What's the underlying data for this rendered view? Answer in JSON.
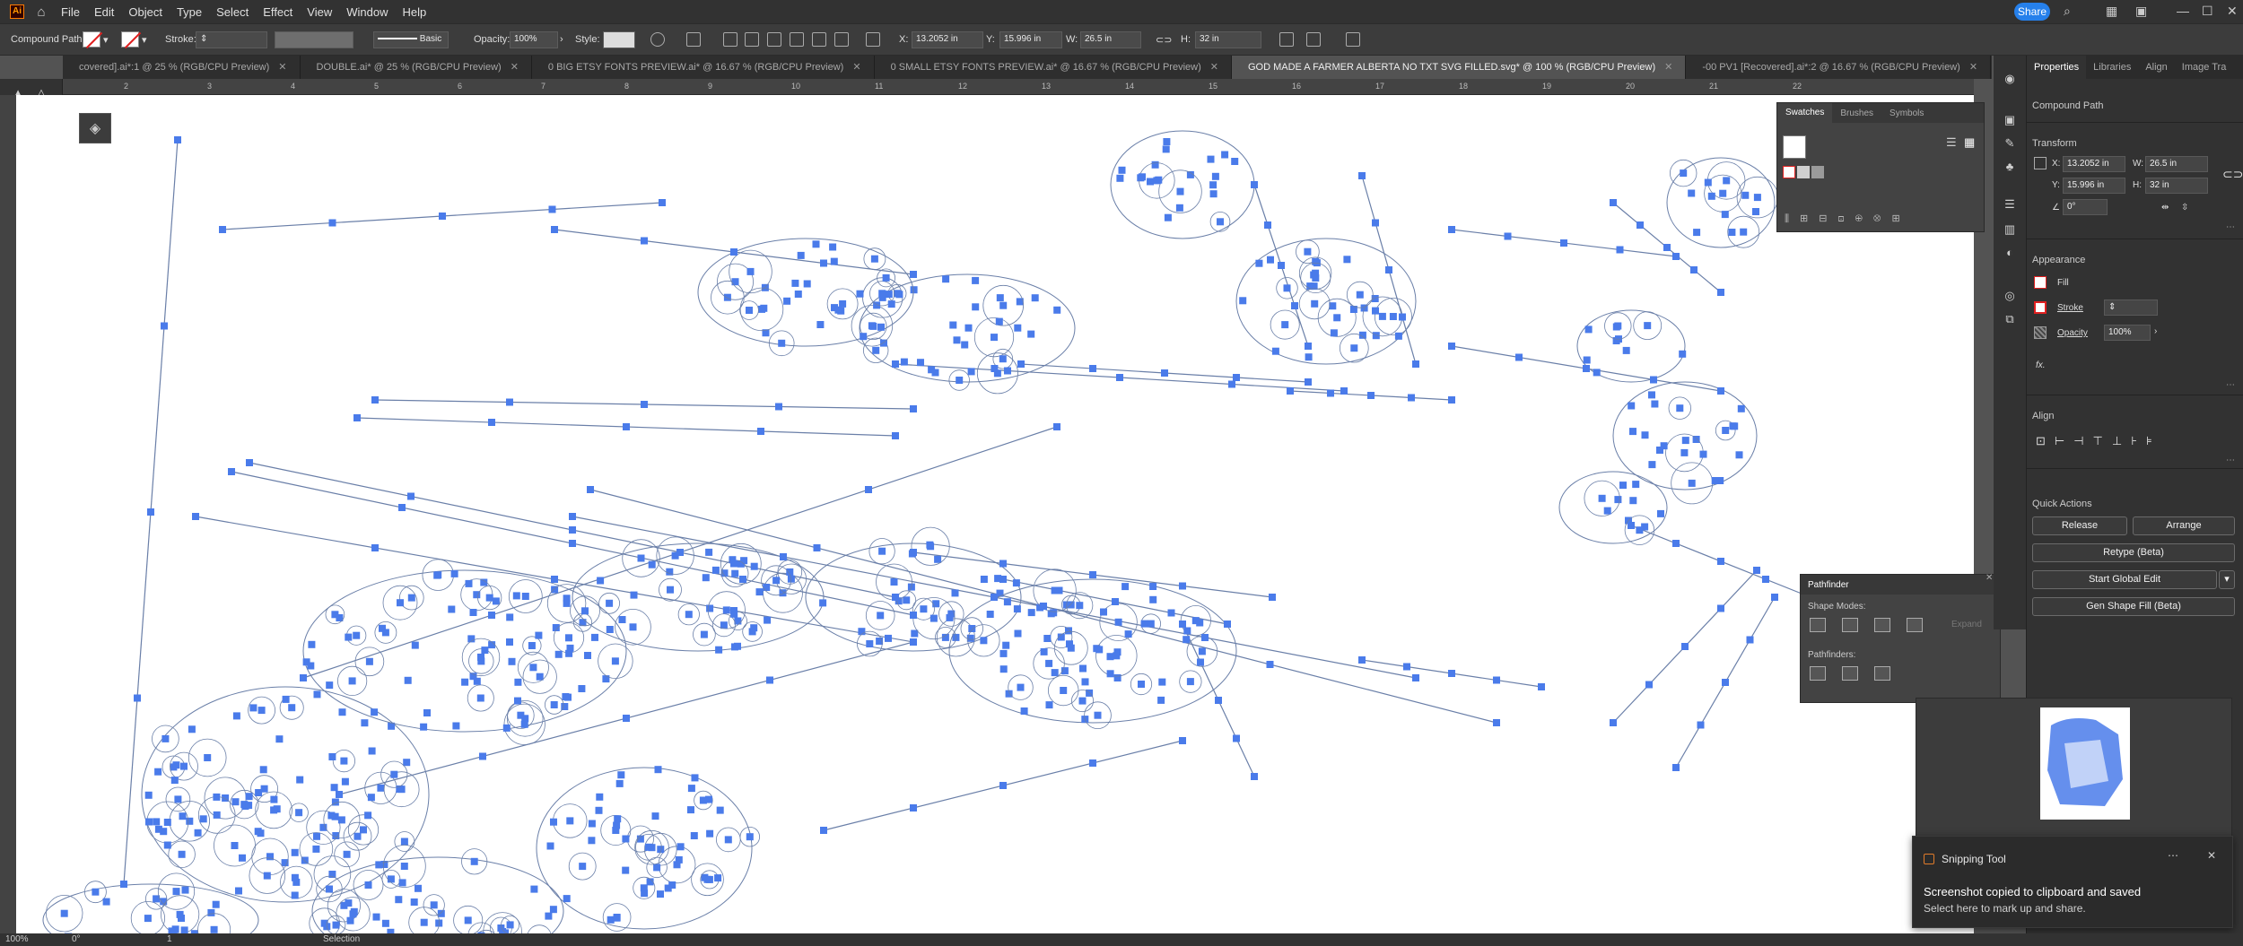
{
  "menubar": {
    "app_logo": "Ai",
    "items": [
      "File",
      "Edit",
      "Object",
      "Type",
      "Select",
      "Effect",
      "View",
      "Window",
      "Help"
    ],
    "share": "Share"
  },
  "control": {
    "selection_type": "Compound Path",
    "stroke_label": "Stroke:",
    "stroke_profile": "Basic",
    "opacity_label": "Opacity:",
    "opacity_value": "100%",
    "style_label": "Style:",
    "x_label": "X:",
    "x_value": "13.2052 in",
    "y_label": "Y:",
    "y_value": "15.996 in",
    "w_label": "W:",
    "w_value": "26.5 in",
    "h_label": "H:",
    "h_value": "32 in"
  },
  "tabs": [
    {
      "label": "covered].ai*:1 @ 25 % (RGB/CPU Preview)",
      "active": false
    },
    {
      "label": "DOUBLE.ai* @ 25 % (RGB/CPU Preview)",
      "active": false
    },
    {
      "label": "0 BIG ETSY FONTS PREVIEW.ai* @ 16.67 % (RGB/CPU Preview)",
      "active": false
    },
    {
      "label": "0 SMALL ETSY FONTS PREVIEW.ai* @ 16.67 % (RGB/CPU Preview)",
      "active": false
    },
    {
      "label": "GOD MADE A FARMER ALBERTA NO TXT SVG FILLED.svg* @ 100 % (RGB/CPU Preview)",
      "active": true
    },
    {
      "label": "-00 PV1 [Recovered].ai*:2 @ 16.67 % (RGB/CPU Preview)",
      "active": false
    }
  ],
  "ruler": {
    "top": [
      "2",
      "3",
      "4",
      "5",
      "6",
      "7",
      "8",
      "9",
      "10",
      "11",
      "12",
      "13",
      "14",
      "15",
      "16",
      "17",
      "18",
      "19",
      "20",
      "21",
      "22"
    ]
  },
  "swatches_panel": {
    "tabs": [
      "Swatches",
      "Brushes",
      "Symbols"
    ]
  },
  "pathfinder_panel": {
    "title": "Pathfinder",
    "shape_modes": "Shape Modes:",
    "pathfinders": "Pathfinders:",
    "expand": "Expand"
  },
  "properties": {
    "tabs": [
      "Properties",
      "Libraries",
      "Align",
      "Image Tra"
    ],
    "object_type": "Compound Path",
    "transform_title": "Transform",
    "x": "13.2052 in",
    "y": "15.996 in",
    "w": "26.5 in",
    "h": "32 in",
    "angle": "0°",
    "appearance_title": "Appearance",
    "fill": "Fill",
    "stroke": "Stroke",
    "opacity": "Opacity",
    "opacity_value": "100%",
    "fx": "fx.",
    "align_title": "Align",
    "quick_actions_title": "Quick Actions",
    "release": "Release",
    "arrange": "Arrange",
    "retype": "Retype (Beta)",
    "global_edit": "Start Global Edit",
    "gen_fill": "Gen Shape Fill (Beta)"
  },
  "toast": {
    "app": "Snipping Tool",
    "message": "Screenshot copied to clipboard and saved",
    "sub": "Select here to mark up and share."
  },
  "status": {
    "zoom": "100%",
    "angle": "0°",
    "artboard": "1",
    "tool": "Selection"
  },
  "colors": {
    "anchor": "#4a7bea",
    "path": "#6a7fa8",
    "accent": "#2680eb"
  }
}
